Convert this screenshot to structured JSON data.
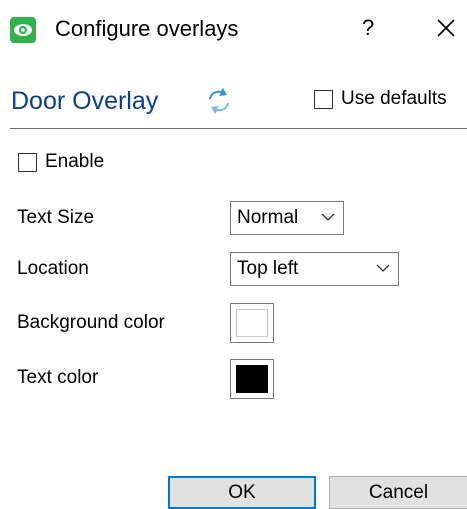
{
  "window": {
    "title": "Configure overlays",
    "help_label": "?",
    "icon": "eye-icon",
    "close_icon": "close-icon"
  },
  "section": {
    "title": "Door Overlay",
    "refresh_icon": "refresh-icon",
    "use_defaults_label": "Use defaults",
    "use_defaults_checked": false
  },
  "enable": {
    "label": "Enable",
    "checked": false
  },
  "fields": {
    "text_size": {
      "label": "Text Size",
      "value": "Normal"
    },
    "location": {
      "label": "Location",
      "value": "Top left"
    },
    "background_color": {
      "label": "Background color",
      "color": "#ffffff"
    },
    "text_color": {
      "label": "Text color",
      "color": "#000000"
    }
  },
  "buttons": {
    "ok": "OK",
    "cancel": "Cancel"
  },
  "colors": {
    "accent": "#0078d7",
    "title": "#0b3d91",
    "icon_green": "#2fb34a"
  }
}
